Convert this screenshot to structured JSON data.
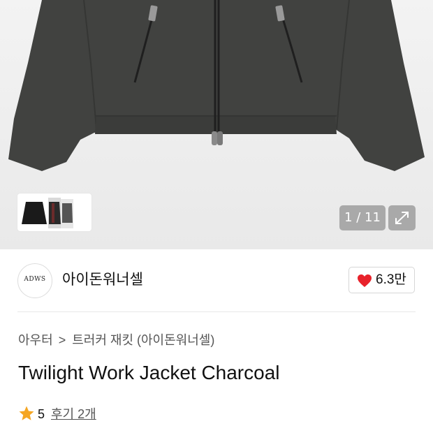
{
  "gallery": {
    "counter": "1 / 11",
    "colors": {
      "jacket": "#3f403e",
      "background": "#efefef"
    }
  },
  "seller": {
    "logo_text": "ADWS",
    "name": "아이돈워너셀"
  },
  "likes": {
    "count": "6.3만",
    "color": "#e8222b"
  },
  "breadcrumb": {
    "category": "아우터",
    "subcategory": "트러커 재킷 (아이돈워너셀)"
  },
  "product": {
    "title": "Twilight Work Jacket Charcoal"
  },
  "rating": {
    "score": "5",
    "reviews_label": "후기 2개",
    "star_color": "#f5a623"
  }
}
